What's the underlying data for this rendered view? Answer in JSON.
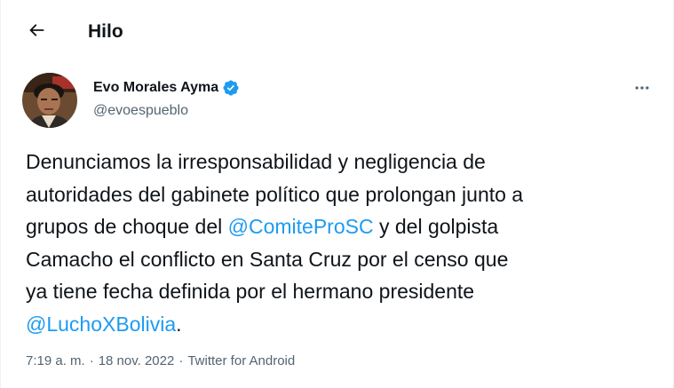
{
  "header": {
    "title": "Hilo"
  },
  "tweet": {
    "author_name": "Evo Morales Ayma",
    "handle": "@evoespueblo",
    "text_lines": {
      "l1": "Denunciamos la irresponsabilidad y negligencia de",
      "l2": "autoridades del gabinete político que prolongan junto a",
      "l3_a": "grupos de choque del ",
      "l3_mention": "@ComiteProSC",
      "l3_b": " y del golpista",
      "l4": "Camacho el conflicto en Santa Cruz por el censo que",
      "l5": "ya tiene fecha definida por el hermano presidente",
      "l6_mention": "@LuchoXBolivia",
      "l6_b": "."
    },
    "time": "7:19 a. m.",
    "separator": "·",
    "date": "18 nov. 2022",
    "source": "Twitter for Android"
  },
  "colors": {
    "link": "#1d9bf0",
    "secondary_text": "#536471",
    "primary_text": "#0f1419",
    "verified": "#1d9bf0"
  },
  "icons": {
    "back": "arrow-left-icon",
    "verified": "verified-badge-icon",
    "more": "more-horizontal-icon"
  }
}
